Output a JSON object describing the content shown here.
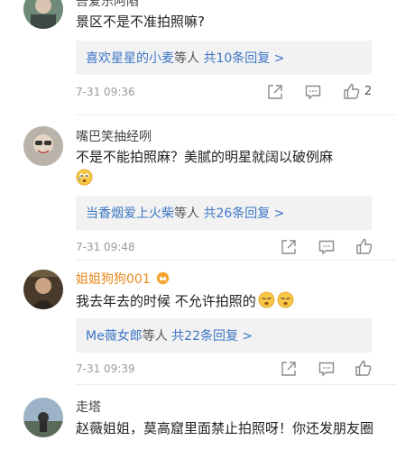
{
  "comments": [
    {
      "username": "吾爱乐阿陷",
      "text": "景区不是不准拍照嘛?",
      "reply_user": "喜欢星星的小麦",
      "reply_mid": "等人",
      "reply_count": "共10条回复 >",
      "time": "7-31 09:36",
      "likes": "2"
    },
    {
      "username": "嘴巴笑抽经咧",
      "text": "不是不能拍照麻？美腻的明星就阔以破例麻",
      "reply_user": "当香烟爱上火柴",
      "reply_mid": "等人",
      "reply_count": "共26条回复 >",
      "time": "7-31 09:48"
    },
    {
      "username": "姐姐狗狗001",
      "text": "我去年去的时候 不允许拍照的",
      "reply_user": "Me薇女郎",
      "reply_mid": "等人",
      "reply_count": "共22条回复 >",
      "time": "7-31 09:39"
    },
    {
      "username": "走塔",
      "text": "赵薇姐姐，莫高窟里面禁止拍照呀！你还发朋友圈"
    }
  ],
  "icons": {
    "share": "share-icon",
    "comment": "comment-icon",
    "like": "thumbs-up-icon",
    "emoji": "sad-face-emoji-icon",
    "badge": "crown-badge-icon"
  },
  "colors": {
    "link_blue": "#3c76c6",
    "username_orange": "#e8891c",
    "meta_grey": "#9a9a9a"
  }
}
